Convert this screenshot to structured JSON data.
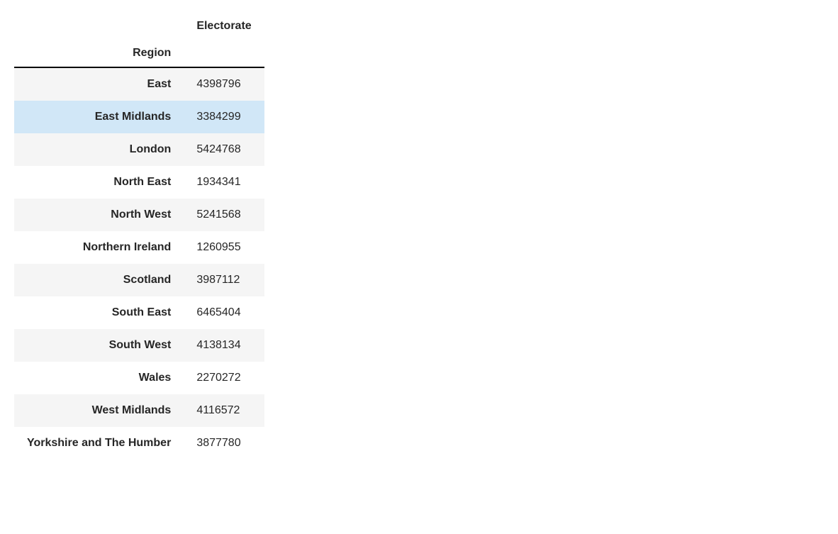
{
  "columns": {
    "value_label": "Electorate",
    "index_label": "Region"
  },
  "rows": [
    {
      "region": "East",
      "electorate": "4398796"
    },
    {
      "region": "East Midlands",
      "electorate": "3384299"
    },
    {
      "region": "London",
      "electorate": "5424768"
    },
    {
      "region": "North East",
      "electorate": "1934341"
    },
    {
      "region": "North West",
      "electorate": "5241568"
    },
    {
      "region": "Northern Ireland",
      "electorate": "1260955"
    },
    {
      "region": "Scotland",
      "electorate": "3987112"
    },
    {
      "region": "South East",
      "electorate": "6465404"
    },
    {
      "region": "South West",
      "electorate": "4138134"
    },
    {
      "region": "Wales",
      "electorate": "2270272"
    },
    {
      "region": "West Midlands",
      "electorate": "4116572"
    },
    {
      "region": "Yorkshire and The Humber",
      "electorate": "3877780"
    }
  ],
  "highlight_index": 1,
  "chart_data": {
    "type": "table",
    "index_name": "Region",
    "columns": [
      "Electorate"
    ],
    "index": [
      "East",
      "East Midlands",
      "London",
      "North East",
      "North West",
      "Northern Ireland",
      "Scotland",
      "South East",
      "South West",
      "Wales",
      "West Midlands",
      "Yorkshire and The Humber"
    ],
    "data": [
      [
        4398796
      ],
      [
        3384299
      ],
      [
        5424768
      ],
      [
        1934341
      ],
      [
        5241568
      ],
      [
        1260955
      ],
      [
        3987112
      ],
      [
        6465404
      ],
      [
        4138134
      ],
      [
        2270272
      ],
      [
        4116572
      ],
      [
        3877780
      ]
    ]
  }
}
